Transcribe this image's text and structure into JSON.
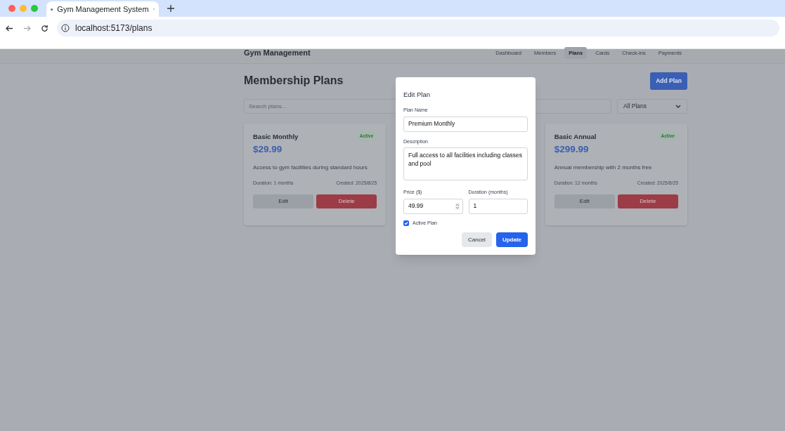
{
  "browser": {
    "tab_title": "Gym Management System",
    "url": "localhost:5173/plans"
  },
  "navbar": {
    "brand": "Gym Management",
    "links": [
      {
        "label": "Dashboard",
        "selected": false
      },
      {
        "label": "Members",
        "selected": false
      },
      {
        "label": "Plans",
        "selected": true
      },
      {
        "label": "Cards",
        "selected": false
      },
      {
        "label": "Check-ins",
        "selected": false
      },
      {
        "label": "Payments",
        "selected": false
      }
    ]
  },
  "page": {
    "title": "Membership Plans",
    "add_button": "Add Plan",
    "search": {
      "placeholder": "Search plans..."
    },
    "filter": {
      "value": "All Plans"
    }
  },
  "plans": [
    {
      "name": "Basic Monthly",
      "status": "Active",
      "price": "$29.99",
      "description": "Access to gym facilities during standard hours",
      "duration": "Duration: 1 months",
      "created": "Created: 2025/8/25",
      "edit": "Edit",
      "delete": "Delete"
    },
    {
      "name": "Basic Annual",
      "status": "Active",
      "price": "$299.99",
      "description": "Annual membership with 2 months free",
      "duration": "Duration: 12 months",
      "created": "Created: 2025/8/25",
      "edit": "Edit",
      "delete": "Delete"
    }
  ],
  "dialog": {
    "title": "Edit Plan",
    "name_label": "Plan Name",
    "name_value": "Premium Monthly",
    "description_label": "Description",
    "description_value": "Full access to all facilities including classes and pool",
    "price_label": "Price ($)",
    "price_value": "49.99",
    "duration_label": "Duration (months)",
    "duration_value": "1",
    "active_label": "Active Plan",
    "active_checked": true,
    "cancel": "Cancel",
    "update": "Update"
  }
}
